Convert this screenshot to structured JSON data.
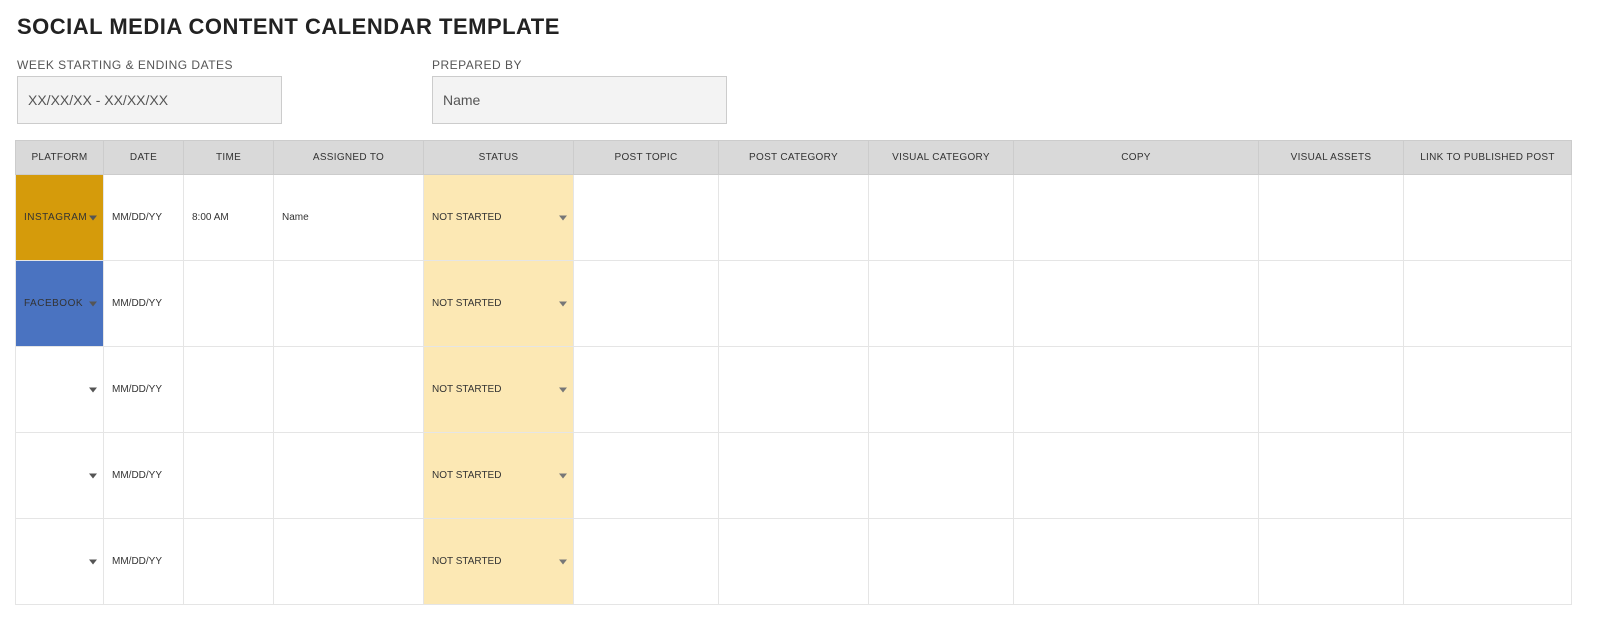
{
  "title": "SOCIAL MEDIA CONTENT CALENDAR TEMPLATE",
  "meta": {
    "week_label": "WEEK STARTING & ENDING DATES",
    "week_value": "XX/XX/XX - XX/XX/XX",
    "prepared_label": "PREPARED BY",
    "prepared_value": "Name"
  },
  "headers": {
    "platform": "PLATFORM",
    "date": "DATE",
    "time": "TIME",
    "assigned_to": "ASSIGNED TO",
    "status": "STATUS",
    "post_topic": "POST TOPIC",
    "post_category": "POST CATEGORY",
    "visual_category": "VISUAL CATEGORY",
    "copy": "COPY",
    "visual_assets": "VISUAL ASSETS",
    "link": "LINK TO PUBLISHED POST"
  },
  "rows": [
    {
      "platform": "INSTAGRAM",
      "platform_class": "instagram",
      "date": "MM/DD/YY",
      "time": "8:00 AM",
      "assigned_to": "Name",
      "status": "NOT STARTED",
      "post_topic": "",
      "post_category": "",
      "visual_category": "",
      "copy": "",
      "visual_assets": "",
      "link": ""
    },
    {
      "platform": "FACEBOOK",
      "platform_class": "facebook",
      "date": "MM/DD/YY",
      "time": "",
      "assigned_to": "",
      "status": "NOT STARTED",
      "post_topic": "",
      "post_category": "",
      "visual_category": "",
      "copy": "",
      "visual_assets": "",
      "link": ""
    },
    {
      "platform": "",
      "platform_class": "empty",
      "date": "MM/DD/YY",
      "time": "",
      "assigned_to": "",
      "status": "NOT STARTED",
      "post_topic": "",
      "post_category": "",
      "visual_category": "",
      "copy": "",
      "visual_assets": "",
      "link": ""
    },
    {
      "platform": "",
      "platform_class": "empty",
      "date": "MM/DD/YY",
      "time": "",
      "assigned_to": "",
      "status": "NOT STARTED",
      "post_topic": "",
      "post_category": "",
      "visual_category": "",
      "copy": "",
      "visual_assets": "",
      "link": ""
    },
    {
      "platform": "",
      "platform_class": "empty",
      "date": "MM/DD/YY",
      "time": "",
      "assigned_to": "",
      "status": "NOT STARTED",
      "post_topic": "",
      "post_category": "",
      "visual_category": "",
      "copy": "",
      "visual_assets": "",
      "link": ""
    }
  ]
}
